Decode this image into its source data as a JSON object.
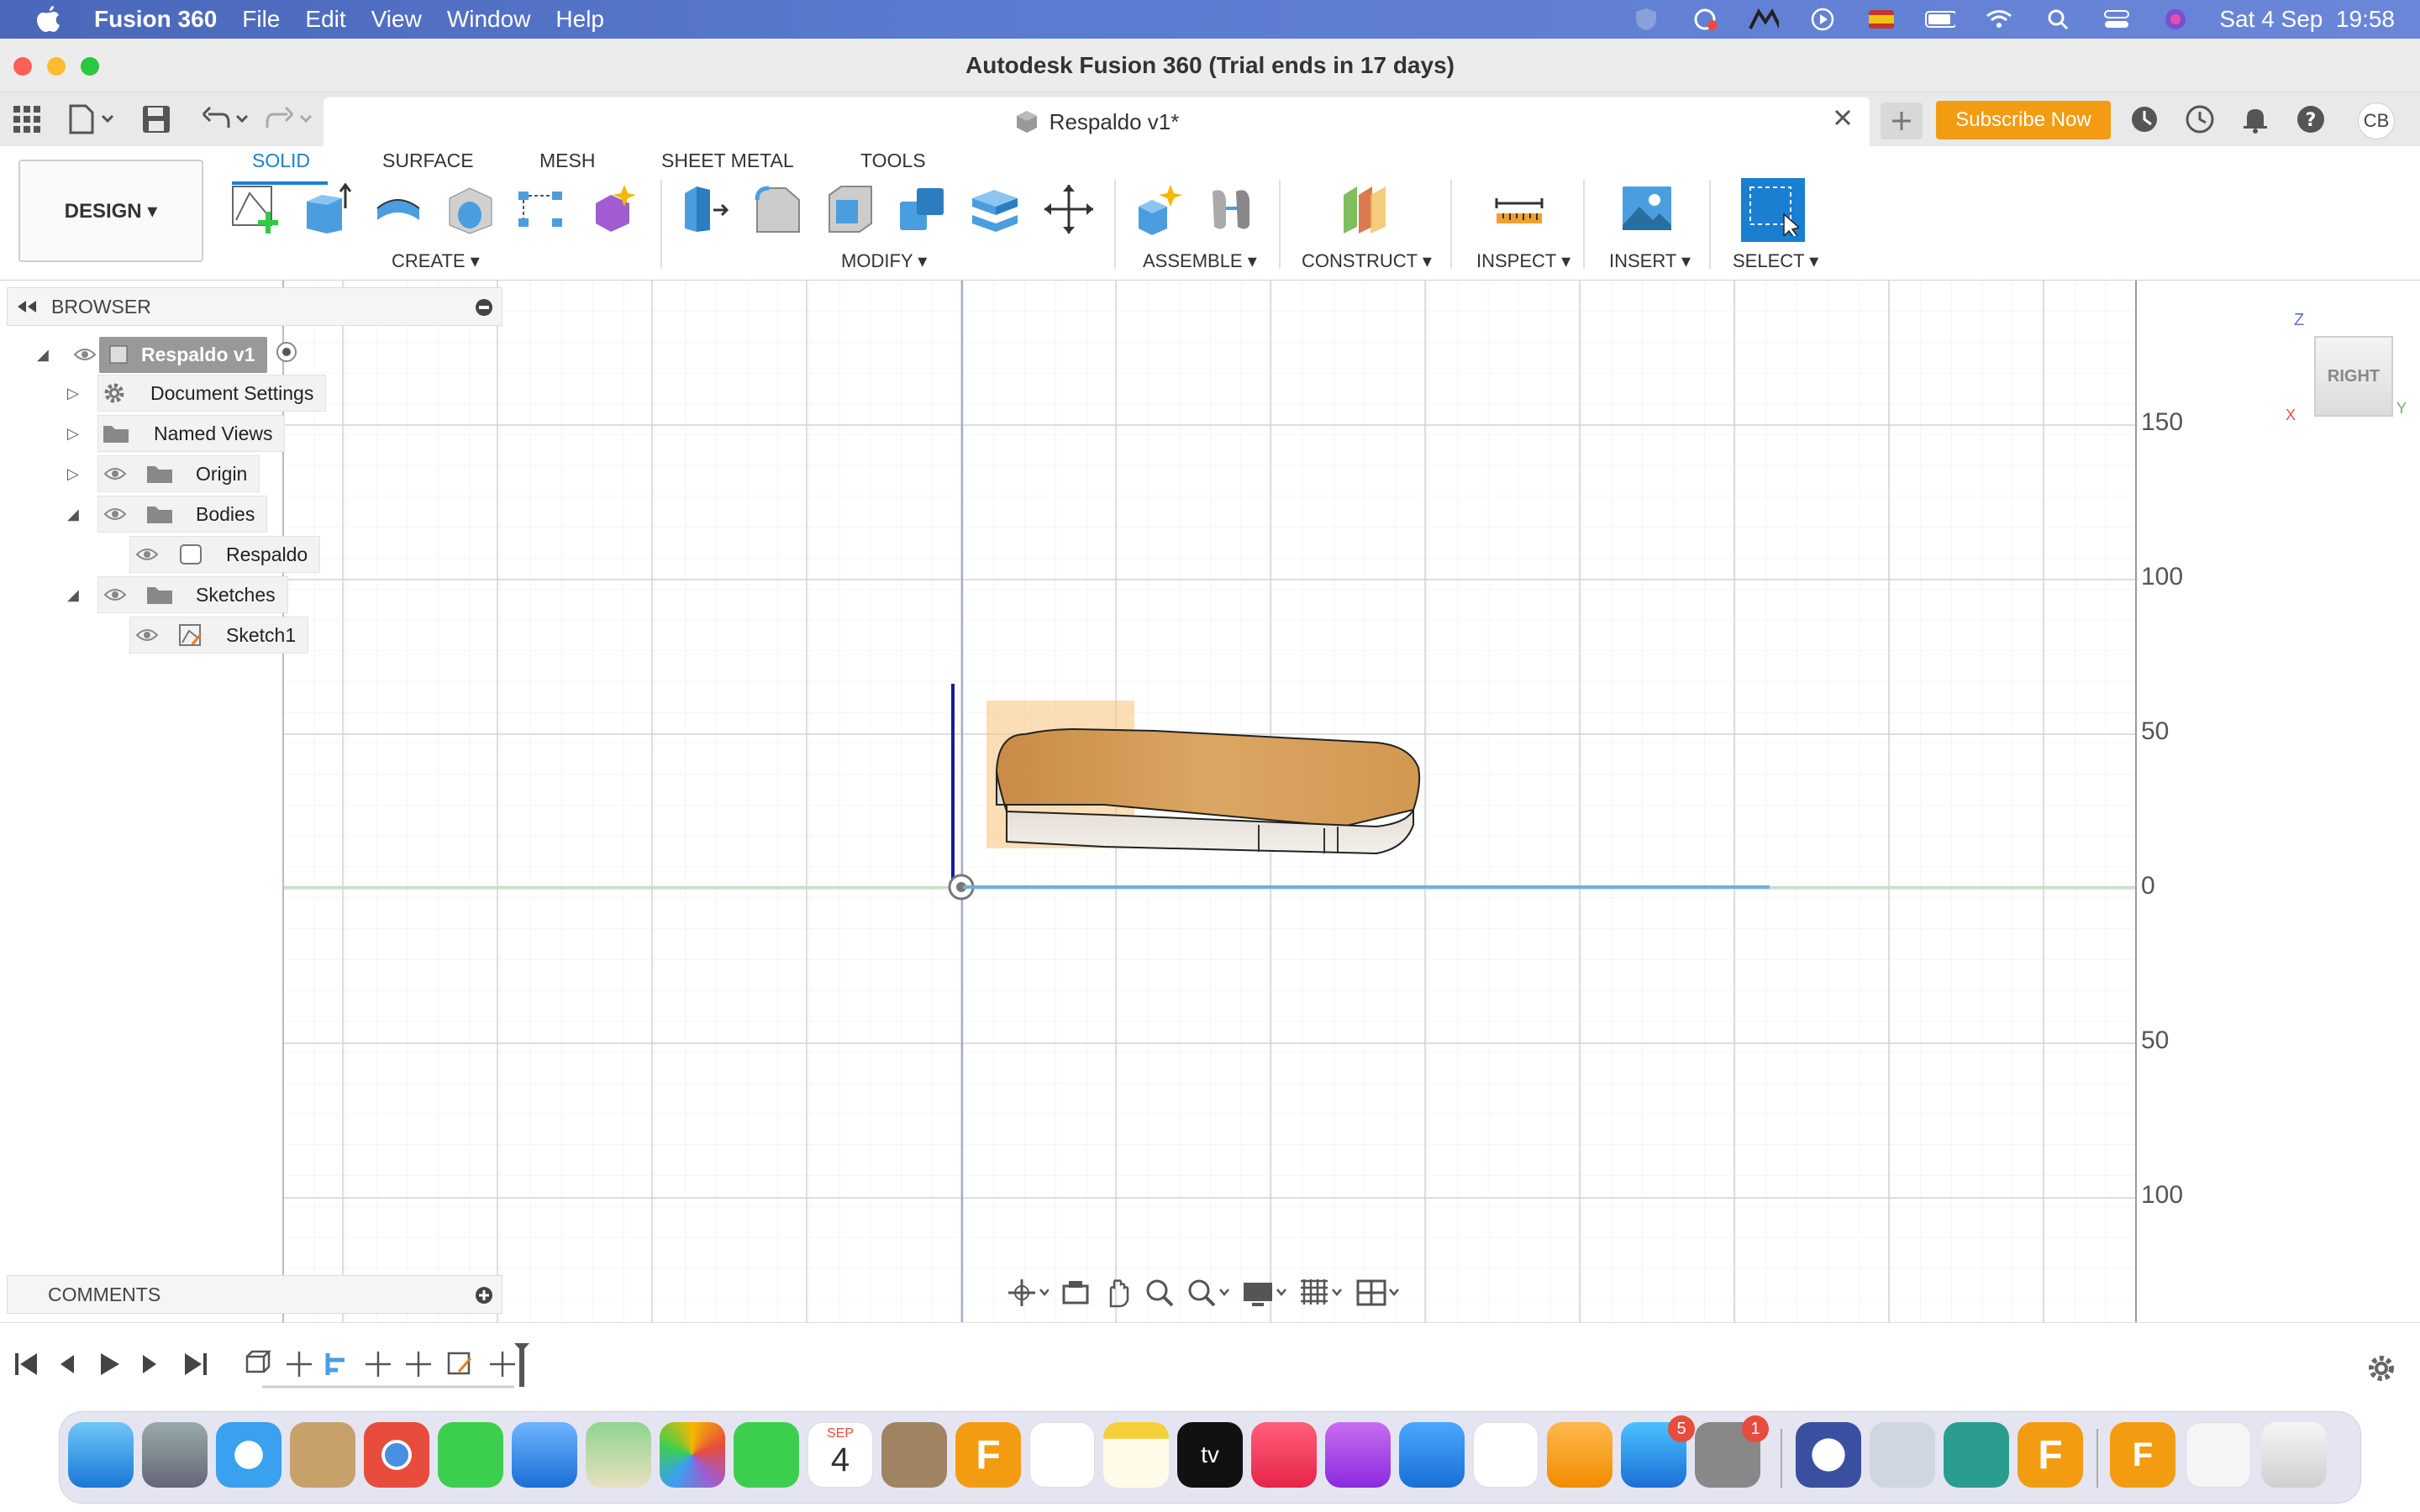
{
  "menubar": {
    "app_name": "Fusion 360",
    "items": [
      "File",
      "Edit",
      "View",
      "Window",
      "Help"
    ],
    "clock": "Sat 4 Sep  19:58"
  },
  "window": {
    "title": "Autodesk Fusion 360 (Trial ends in 17 days)"
  },
  "tabbar": {
    "doc_tab": "Respaldo v1*",
    "subscribe": "Subscribe Now",
    "user_initials": "CB"
  },
  "ribbon": {
    "workspace": "DESIGN ▾",
    "tabs": [
      "SOLID",
      "SURFACE",
      "MESH",
      "SHEET METAL",
      "TOOLS"
    ],
    "active_tab": "SOLID",
    "groups": [
      "CREATE ▾",
      "MODIFY ▾",
      "ASSEMBLE ▾",
      "CONSTRUCT ▾",
      "INSPECT ▾",
      "INSERT ▾",
      "SELECT ▾"
    ]
  },
  "browser": {
    "title": "BROWSER",
    "items": [
      {
        "label": "Respaldo v1"
      },
      {
        "label": "Document Settings"
      },
      {
        "label": "Named Views"
      },
      {
        "label": "Origin"
      },
      {
        "label": "Bodies"
      },
      {
        "label": "Respaldo"
      },
      {
        "label": "Sketches"
      },
      {
        "label": "Sketch1"
      }
    ]
  },
  "comments": {
    "title": "COMMENTS"
  },
  "viewcube": {
    "face": "RIGHT",
    "axis_z": "Z",
    "axis_y": "Y",
    "axis_x": "X"
  },
  "ruler": {
    "labels": [
      "150",
      "100",
      "50",
      "0",
      "50",
      "100"
    ]
  },
  "colors": {
    "accent": "#1a7fd1",
    "subscribe": "#f39c12",
    "body": "#d9a45e"
  },
  "dock": {
    "calendar_month": "SEP",
    "calendar_day": "4",
    "appstore_badge": "5",
    "prefs_badge": "1",
    "tv_label": "tv"
  }
}
